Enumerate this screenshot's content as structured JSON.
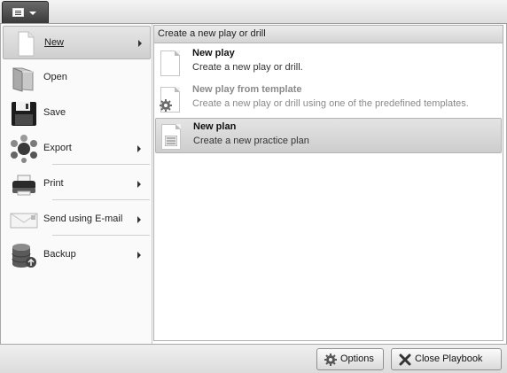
{
  "app_menu": {
    "icon": "document-list-icon"
  },
  "menu": {
    "items": [
      {
        "label": "New",
        "icon": "new-document-icon",
        "has_submenu": true,
        "selected": true
      },
      {
        "label": "Open",
        "icon": "folder-open-icon",
        "has_submenu": false
      },
      {
        "label": "Save",
        "icon": "floppy-disk-icon",
        "has_submenu": false
      },
      {
        "label": "Export",
        "icon": "export-icon",
        "has_submenu": true
      },
      {
        "label": "Print",
        "icon": "printer-icon",
        "has_submenu": true
      },
      {
        "label": "Send using E-mail",
        "icon": "email-envelope-icon",
        "has_submenu": true
      },
      {
        "label": "Backup",
        "icon": "database-backup-icon",
        "has_submenu": true
      }
    ]
  },
  "panel": {
    "header": "Create a new play or drill",
    "options": [
      {
        "title": "New play",
        "desc": "Create a new play or drill.",
        "icon": "blank-document-icon",
        "enabled": true
      },
      {
        "title": "New play from template",
        "desc": "Create a new play or drill using one of the predefined templates.",
        "icon": "template-document-icon",
        "enabled": false
      },
      {
        "title": "New plan",
        "desc": "Create a new practice plan",
        "icon": "plan-document-icon",
        "enabled": true,
        "highlighted": true
      }
    ]
  },
  "footer": {
    "options_label": "Options",
    "close_label": "Close Playbook"
  },
  "colors": {
    "selection_bg": "#d6d6d6",
    "disabled_text": "#8a8a8a"
  }
}
